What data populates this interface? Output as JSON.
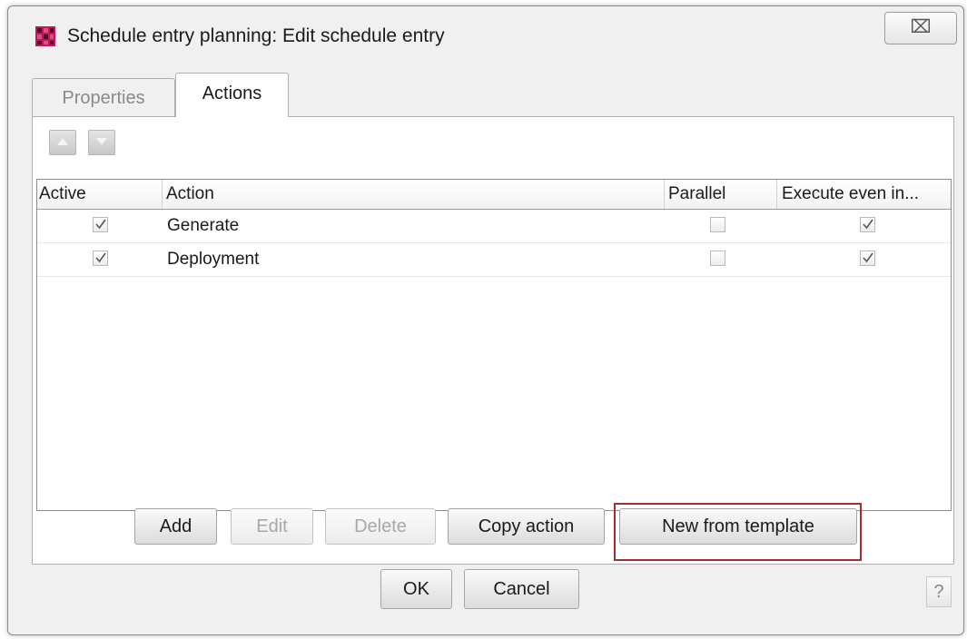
{
  "window": {
    "title": "Schedule entry planning:  Edit schedule entry",
    "close_symbol": "⌧"
  },
  "tabs": [
    {
      "label": "Properties",
      "active": false
    },
    {
      "label": "Actions",
      "active": true
    }
  ],
  "toolbar": {
    "move_up_icon": "arrow-up-icon",
    "move_down_icon": "arrow-down-icon"
  },
  "table": {
    "columns": [
      "Active",
      "Action",
      "Parallel",
      "Execute even in..."
    ],
    "rows": [
      {
        "active": true,
        "action": "Generate",
        "parallel": false,
        "execute_even": true
      },
      {
        "active": true,
        "action": "Deployment",
        "parallel": false,
        "execute_even": true
      }
    ]
  },
  "action_buttons": {
    "add": "Add",
    "edit": "Edit",
    "delete": "Delete",
    "copy": "Copy action",
    "new_from_template": "New from template"
  },
  "dialog_buttons": {
    "ok": "OK",
    "cancel": "Cancel",
    "help": "?"
  },
  "colors": {
    "highlight_border": "#a03030",
    "app_icon_primary": "#c2185b"
  }
}
